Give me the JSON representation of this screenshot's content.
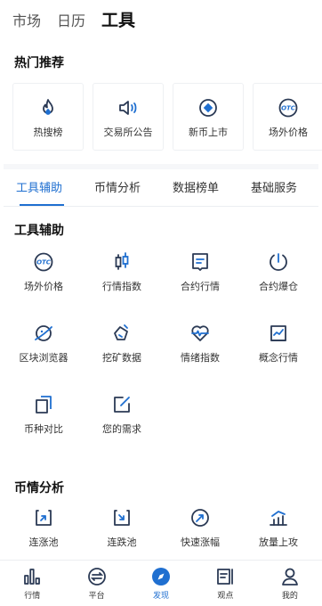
{
  "top_tabs": [
    "市场",
    "日历",
    "工具"
  ],
  "hot": {
    "title": "热门推荐",
    "items": [
      {
        "label": "热搜榜",
        "icon": "flame-icon"
      },
      {
        "label": "交易所公告",
        "icon": "speaker-icon"
      },
      {
        "label": "新币上市",
        "icon": "new-coin-icon"
      },
      {
        "label": "场外价格",
        "icon": "otc-icon"
      }
    ]
  },
  "sub_tabs": [
    "工具辅助",
    "币情分析",
    "数据榜单",
    "基础服务"
  ],
  "tools": {
    "title": "工具辅助",
    "items": [
      {
        "label": "场外价格",
        "icon": "otc-icon"
      },
      {
        "label": "行情指数",
        "icon": "candlestick-icon"
      },
      {
        "label": "合约行情",
        "icon": "contract-icon"
      },
      {
        "label": "合约爆仓",
        "icon": "liquidation-gauge-icon"
      },
      {
        "label": "区块浏览器",
        "icon": "planet-icon"
      },
      {
        "label": "挖矿数据",
        "icon": "mining-icon"
      },
      {
        "label": "情绪指数",
        "icon": "heart-pulse-icon"
      },
      {
        "label": "概念行情",
        "icon": "trend-chart-icon"
      },
      {
        "label": "币种对比",
        "icon": "compare-icon"
      },
      {
        "label": "您的需求",
        "icon": "edit-icon"
      }
    ]
  },
  "analysis": {
    "title": "币情分析",
    "items": [
      {
        "label": "连涨池",
        "icon": "rise-pool-icon"
      },
      {
        "label": "连跌池",
        "icon": "fall-pool-icon"
      },
      {
        "label": "快速涨幅",
        "icon": "rapid-rise-icon"
      },
      {
        "label": "放量上攻",
        "icon": "volume-up-icon"
      }
    ]
  },
  "bottom_nav": [
    {
      "label": "行情",
      "icon": "market-icon"
    },
    {
      "label": "平台",
      "icon": "platform-icon"
    },
    {
      "label": "发现",
      "icon": "discover-compass-icon"
    },
    {
      "label": "观点",
      "icon": "viewpoint-icon"
    },
    {
      "label": "我的",
      "icon": "profile-icon"
    }
  ],
  "colors": {
    "accent": "#1f6fd0",
    "icon_dark": "#2b3a55"
  }
}
